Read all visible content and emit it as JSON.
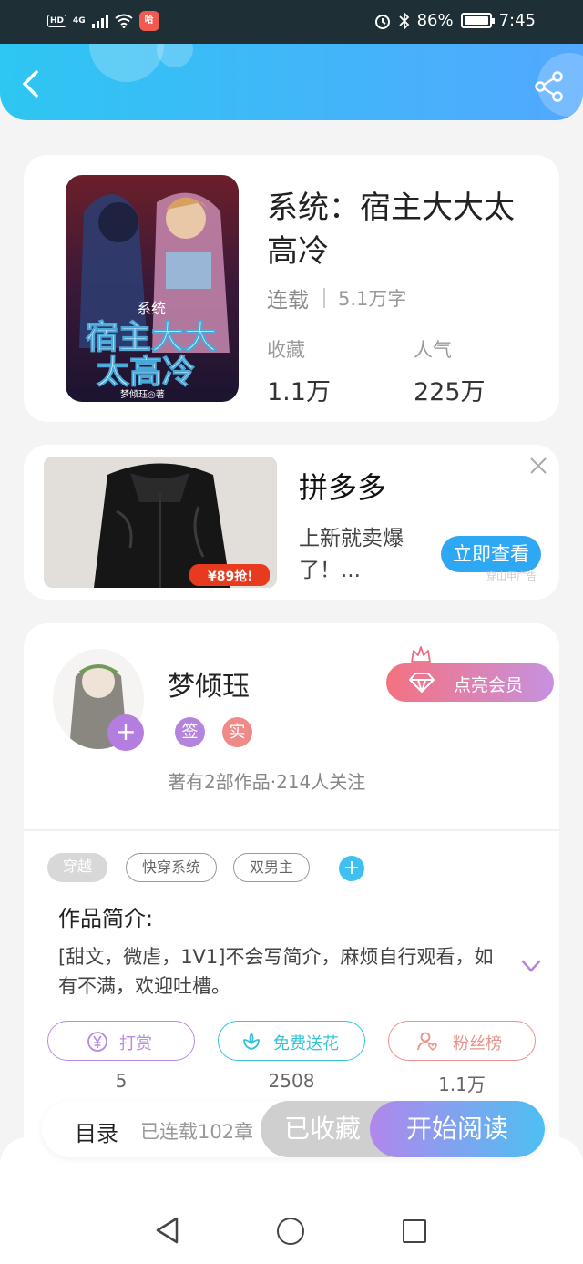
{
  "status_bar": {
    "hd": "HD",
    "network": "4G",
    "app_badge": "哈",
    "battery": "86%",
    "time": "7:45"
  },
  "book": {
    "title": "系统：宿主大大太高冷",
    "status": "连载",
    "words": "5.1万字",
    "collect_label": "收藏",
    "collect_value": "1.1万",
    "popularity_label": "人气",
    "popularity_value": "225万",
    "cover_series": "系统",
    "cover_title_1": "宿主大大",
    "cover_title_2": "太高冷",
    "cover_author": "梦倾珏◎著"
  },
  "ad": {
    "title": "拼多多",
    "desc": "上新就卖爆了！...",
    "button": "立即查看",
    "note": "穿山甲广告",
    "price_tag": "¥89抢!"
  },
  "author": {
    "name": "梦倾珏",
    "badge_sign": "签",
    "badge_real": "实",
    "stats": "著有2部作品·214人关注",
    "vip_button": "点亮会员"
  },
  "tags": [
    "穿越",
    "快穿系统",
    "双男主"
  ],
  "intro": {
    "heading": "作品简介:",
    "text": "[甜文，微虐，1V1]不会写简介，麻烦自行观看，如有不满，欢迎吐槽。"
  },
  "actions": [
    {
      "label": "打赏",
      "count": "5",
      "color": "#b88ae0"
    },
    {
      "label": "免费送花",
      "count": "2508",
      "color": "#35c4d6"
    },
    {
      "label": "粉丝榜",
      "count": "1.1万",
      "color": "#e7928c"
    }
  ],
  "bottom_bar": {
    "toc": "目录",
    "serial": "已连载102章",
    "favorited": "已收藏",
    "start_reading": "开始阅读"
  }
}
